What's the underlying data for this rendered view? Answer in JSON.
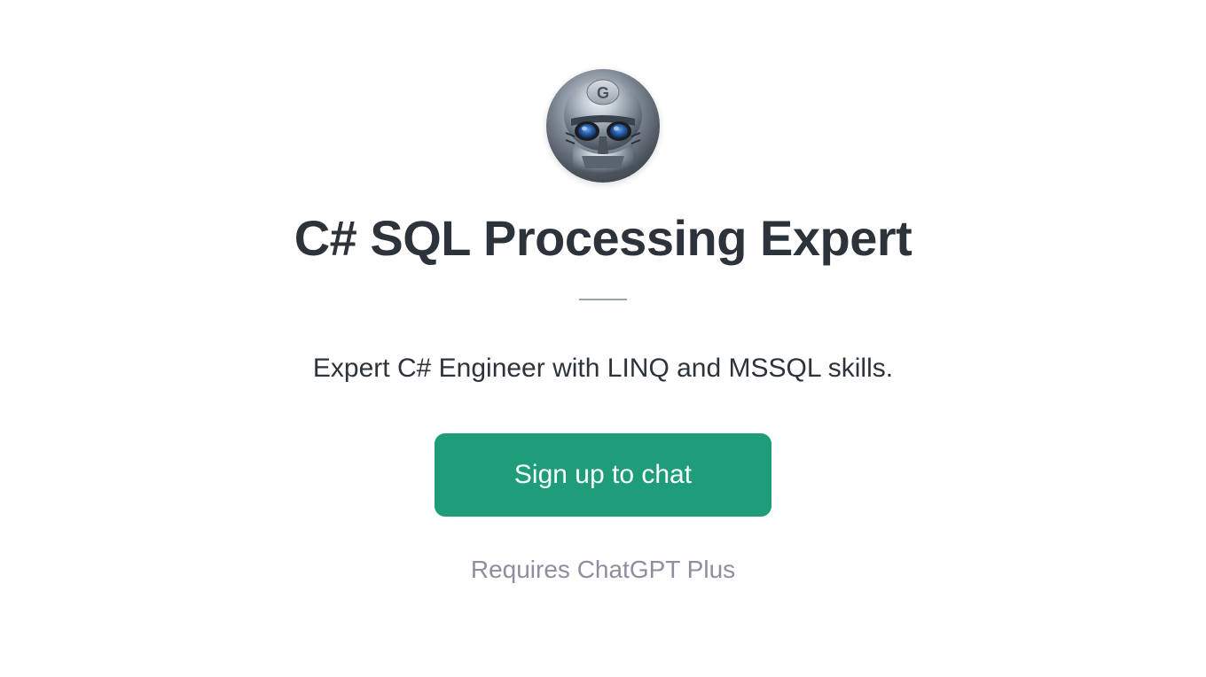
{
  "avatar": {
    "letter": "G"
  },
  "title": "C# SQL Processing Expert",
  "description": "Expert C# Engineer with LINQ and MSSQL skills.",
  "button": {
    "label": "Sign up to chat"
  },
  "requires": "Requires ChatGPT Plus"
}
